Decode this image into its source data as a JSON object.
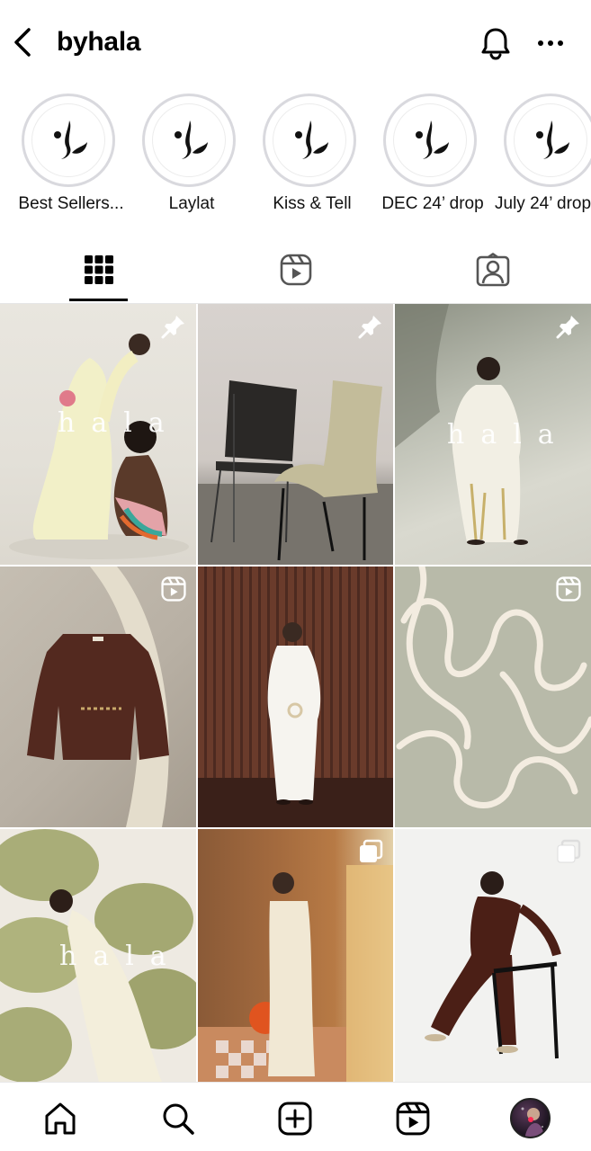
{
  "header": {
    "username": "byhala"
  },
  "highlights": [
    {
      "label": "Best Sellers..."
    },
    {
      "label": "Laylat"
    },
    {
      "label": "Kiss & Tell"
    },
    {
      "label": "DEC 24’ drop"
    },
    {
      "label": "July 24’ drop"
    }
  ],
  "tabs": [
    {
      "name": "posts-grid",
      "icon": "grid-icon",
      "active": true
    },
    {
      "name": "reels",
      "icon": "reels-icon",
      "active": false
    },
    {
      "name": "tagged",
      "icon": "tagged-user-icon",
      "active": false
    }
  ],
  "posts": [
    {
      "badge": "pin-icon",
      "overlay_text": "hala"
    },
    {
      "badge": "pin-icon",
      "overlay_text": ""
    },
    {
      "badge": "pin-icon",
      "overlay_text": "hala"
    },
    {
      "badge": "reels-icon",
      "overlay_text": ""
    },
    {
      "badge": "",
      "overlay_text": ""
    },
    {
      "badge": "reels-icon",
      "overlay_text": ""
    },
    {
      "badge": "",
      "overlay_text": "hala"
    },
    {
      "badge": "carousel-icon",
      "overlay_text": ""
    },
    {
      "badge": "carousel-icon",
      "overlay_text": ""
    }
  ],
  "bottom_nav": [
    {
      "name": "home",
      "icon": "home-icon"
    },
    {
      "name": "search",
      "icon": "search-icon"
    },
    {
      "name": "create",
      "icon": "plus-square-icon"
    },
    {
      "name": "reels",
      "icon": "reels-icon"
    },
    {
      "name": "profile",
      "icon": "avatar"
    }
  ],
  "colors": {
    "notification_dot": "#ff2d55",
    "highlight_ring": "#d9d9de"
  }
}
